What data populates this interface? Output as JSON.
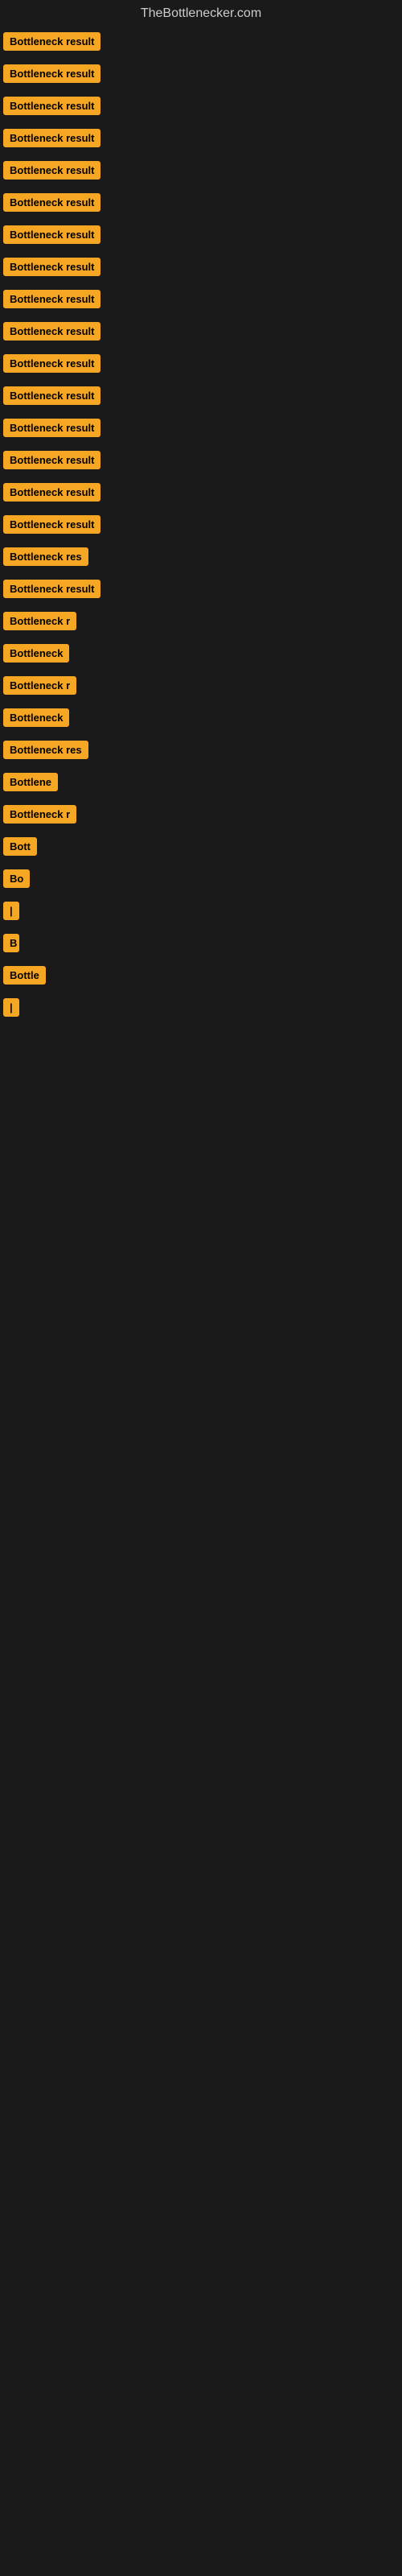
{
  "site": {
    "title": "TheBottlenecker.com"
  },
  "items": [
    {
      "label": "Bottleneck result",
      "width_class": "w-full"
    },
    {
      "label": "Bottleneck result",
      "width_class": "w-full"
    },
    {
      "label": "Bottleneck result",
      "width_class": "w-full"
    },
    {
      "label": "Bottleneck result",
      "width_class": "w-full"
    },
    {
      "label": "Bottleneck result",
      "width_class": "w-full"
    },
    {
      "label": "Bottleneck result",
      "width_class": "w-full"
    },
    {
      "label": "Bottleneck result",
      "width_class": "w-full"
    },
    {
      "label": "Bottleneck result",
      "width_class": "w-full"
    },
    {
      "label": "Bottleneck result",
      "width_class": "w-full"
    },
    {
      "label": "Bottleneck result",
      "width_class": "w-full"
    },
    {
      "label": "Bottleneck result",
      "width_class": "w-full"
    },
    {
      "label": "Bottleneck result",
      "width_class": "w-full"
    },
    {
      "label": "Bottleneck result",
      "width_class": "w-full"
    },
    {
      "label": "Bottleneck result",
      "width_class": "w-full"
    },
    {
      "label": "Bottleneck result",
      "width_class": "w-full"
    },
    {
      "label": "Bottleneck result",
      "width_class": "w-full"
    },
    {
      "label": "Bottleneck res",
      "width_class": "w-large"
    },
    {
      "label": "Bottleneck result",
      "width_class": "w-full"
    },
    {
      "label": "Bottleneck r",
      "width_class": "w-medium"
    },
    {
      "label": "Bottleneck",
      "width_class": "w-small"
    },
    {
      "label": "Bottleneck r",
      "width_class": "w-medium"
    },
    {
      "label": "Bottleneck",
      "width_class": "w-small"
    },
    {
      "label": "Bottleneck res",
      "width_class": "w-large"
    },
    {
      "label": "Bottlene",
      "width_class": "w-xsmall"
    },
    {
      "label": "Bottleneck r",
      "width_class": "w-medium"
    },
    {
      "label": "Bott",
      "width_class": "w-tiny"
    },
    {
      "label": "Bo",
      "width_class": "w-xtiny"
    },
    {
      "label": "|",
      "width_class": "w-micro"
    },
    {
      "label": "B",
      "width_class": "w-micro"
    },
    {
      "label": "Bottle",
      "width_class": "w-small"
    },
    {
      "label": "|",
      "width_class": "w-micro"
    }
  ]
}
